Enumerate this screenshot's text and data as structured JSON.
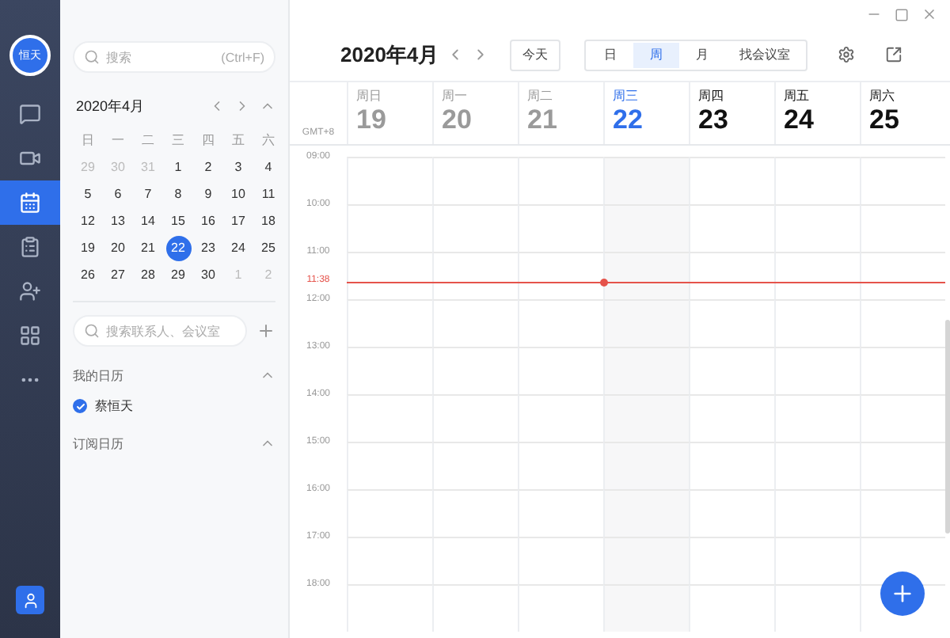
{
  "rail": {
    "avatar": "恒天",
    "items": [
      {
        "kind": "chat",
        "selected": false
      },
      {
        "kind": "video",
        "selected": false
      },
      {
        "kind": "calendar",
        "selected": true
      },
      {
        "kind": "doc",
        "selected": false
      },
      {
        "kind": "contacts",
        "selected": false
      },
      {
        "kind": "apps",
        "selected": false
      },
      {
        "kind": "more",
        "selected": false
      }
    ]
  },
  "sidebar": {
    "search": {
      "placeholder": "搜索",
      "shortcut": "(Ctrl+F)"
    },
    "mini_calendar": {
      "title": "2020年4月",
      "weekdays": [
        "日",
        "一",
        "二",
        "三",
        "四",
        "五",
        "六"
      ],
      "weeks": [
        [
          {
            "day": "29",
            "muted": true,
            "selected": false
          },
          {
            "day": "30",
            "muted": true,
            "selected": false
          },
          {
            "day": "31",
            "muted": true,
            "selected": false
          },
          {
            "day": "1",
            "muted": false,
            "selected": false
          },
          {
            "day": "2",
            "muted": false,
            "selected": false
          },
          {
            "day": "3",
            "muted": false,
            "selected": false
          },
          {
            "day": "4",
            "muted": false,
            "selected": false
          }
        ],
        [
          {
            "day": "5",
            "muted": false,
            "selected": false
          },
          {
            "day": "6",
            "muted": false,
            "selected": false
          },
          {
            "day": "7",
            "muted": false,
            "selected": false
          },
          {
            "day": "8",
            "muted": false,
            "selected": false
          },
          {
            "day": "9",
            "muted": false,
            "selected": false
          },
          {
            "day": "10",
            "muted": false,
            "selected": false
          },
          {
            "day": "11",
            "muted": false,
            "selected": false
          }
        ],
        [
          {
            "day": "12",
            "muted": false,
            "selected": false
          },
          {
            "day": "13",
            "muted": false,
            "selected": false
          },
          {
            "day": "14",
            "muted": false,
            "selected": false
          },
          {
            "day": "15",
            "muted": false,
            "selected": false
          },
          {
            "day": "16",
            "muted": false,
            "selected": false
          },
          {
            "day": "17",
            "muted": false,
            "selected": false
          },
          {
            "day": "18",
            "muted": false,
            "selected": false
          }
        ],
        [
          {
            "day": "19",
            "muted": false,
            "selected": false
          },
          {
            "day": "20",
            "muted": false,
            "selected": false
          },
          {
            "day": "21",
            "muted": false,
            "selected": false
          },
          {
            "day": "22",
            "muted": false,
            "selected": true
          },
          {
            "day": "23",
            "muted": false,
            "selected": false
          },
          {
            "day": "24",
            "muted": false,
            "selected": false
          },
          {
            "day": "25",
            "muted": false,
            "selected": false
          }
        ],
        [
          {
            "day": "26",
            "muted": false,
            "selected": false
          },
          {
            "day": "27",
            "muted": false,
            "selected": false
          },
          {
            "day": "28",
            "muted": false,
            "selected": false
          },
          {
            "day": "29",
            "muted": false,
            "selected": false
          },
          {
            "day": "30",
            "muted": false,
            "selected": false
          },
          {
            "day": "1",
            "muted": true,
            "selected": false
          },
          {
            "day": "2",
            "muted": true,
            "selected": false
          }
        ]
      ]
    },
    "contact_search": {
      "placeholder": "搜索联系人、会议室"
    },
    "sections": [
      {
        "title": "我的日历",
        "expanded": true,
        "calendars": [
          {
            "name": "蔡恒天",
            "checked": true
          }
        ]
      },
      {
        "title": "订阅日历",
        "expanded": true
      }
    ]
  },
  "header": {
    "title": "2020年4月",
    "today": "今天",
    "views": [
      {
        "label": "日",
        "selected": false
      },
      {
        "label": "周",
        "selected": true
      },
      {
        "label": "月",
        "selected": false
      },
      {
        "label": "找会议室",
        "selected": false
      }
    ]
  },
  "timezone": "GMT+8",
  "days": [
    {
      "weekday": "周日",
      "date": "19",
      "kind": "past"
    },
    {
      "weekday": "周一",
      "date": "20",
      "kind": "past"
    },
    {
      "weekday": "周二",
      "date": "21",
      "kind": "past"
    },
    {
      "weekday": "周三",
      "date": "22",
      "kind": "today"
    },
    {
      "weekday": "周四",
      "date": "23",
      "kind": "future"
    },
    {
      "weekday": "周五",
      "date": "24",
      "kind": "future"
    },
    {
      "weekday": "周六",
      "date": "25",
      "kind": "future"
    }
  ],
  "hours": [
    {
      "label": "09:00"
    },
    {
      "label": "10:00"
    },
    {
      "label": "11:00",
      "now": "11:38"
    },
    {
      "label": "12:00"
    },
    {
      "label": "13:00"
    },
    {
      "label": "14:00"
    },
    {
      "label": "15:00"
    },
    {
      "label": "16:00"
    },
    {
      "label": "17:00"
    },
    {
      "label": "18:00"
    }
  ]
}
